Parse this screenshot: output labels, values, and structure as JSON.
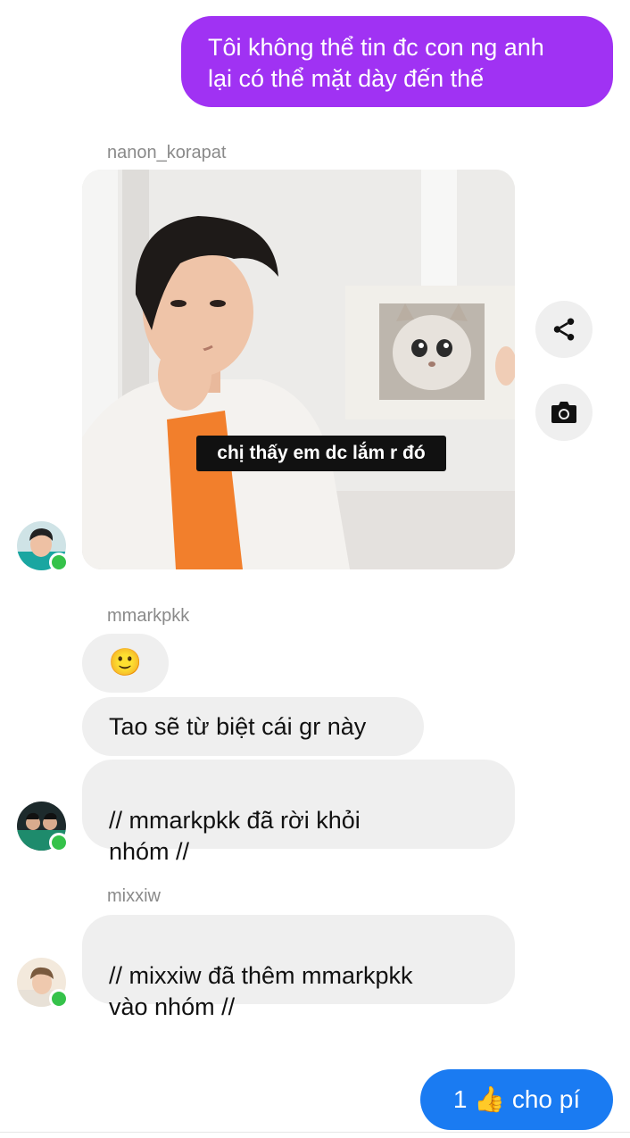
{
  "messages": {
    "outgoing_1": "Tôi không thể tin đc con ng anh\nlại có thể mặt dày đến thế",
    "group1": {
      "sender": "nanon_korapat",
      "image_caption": "chị thấy em dc lắm r đó"
    },
    "group2": {
      "sender": "mmarkpkk",
      "emoji": "🙂",
      "msg1": "Tao sẽ từ biệt cái gr này",
      "msg2": "// mmarkpkk đã rời khỏi\nnhóm //"
    },
    "group3": {
      "sender": "mixxiw",
      "msg1": "// mixxiw đã thêm mmarkpkk\nvào nhóm //"
    },
    "outgoing_2": {
      "count": "1",
      "emoji": "👍",
      "text": "cho pí"
    }
  },
  "icons": {
    "share": "share-icon",
    "camera": "camera-icon"
  },
  "colors": {
    "outgoing_purple": "#a032f3",
    "outgoing_blue": "#1a7bf2",
    "incoming_gray": "#efefef",
    "online_green": "#35c24a"
  }
}
